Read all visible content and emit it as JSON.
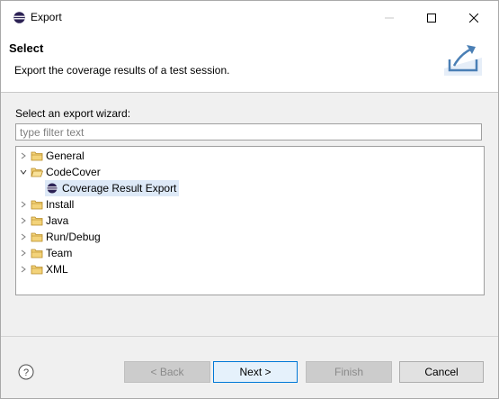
{
  "window": {
    "title": "Export"
  },
  "header": {
    "title": "Select",
    "description": "Export the coverage results of a test session."
  },
  "wizard": {
    "label": "Select an export wizard:",
    "filter_placeholder": "type filter text",
    "filter_value": ""
  },
  "tree": [
    {
      "label": "General",
      "expanded": false,
      "children": []
    },
    {
      "label": "CodeCover",
      "expanded": true,
      "children": [
        {
          "label": "Coverage Result Export",
          "selected": true
        }
      ]
    },
    {
      "label": "Install",
      "expanded": false,
      "children": []
    },
    {
      "label": "Java",
      "expanded": false,
      "children": []
    },
    {
      "label": "Run/Debug",
      "expanded": false,
      "children": []
    },
    {
      "label": "Team",
      "expanded": false,
      "children": []
    },
    {
      "label": "XML",
      "expanded": false,
      "children": []
    }
  ],
  "buttons": {
    "back": "< Back",
    "next": "Next >",
    "finish": "Finish",
    "cancel": "Cancel"
  },
  "icons": {
    "app": "eclipse-icon",
    "export_banner": "export-wizard-icon",
    "help": "help-icon",
    "folder": "folder-icon"
  },
  "colors": {
    "selection": "#dde9f7",
    "default_button_border": "#0078d7",
    "folder": "#e8b84a"
  }
}
